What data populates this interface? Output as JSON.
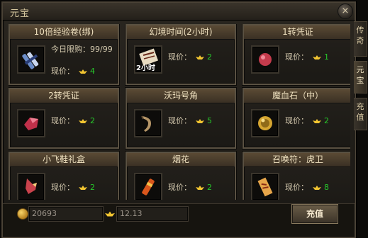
{
  "window": {
    "title": "元宝",
    "close_glyph": "×"
  },
  "side_tabs": [
    {
      "label": "传奇",
      "active": false
    },
    {
      "label": "元宝",
      "active": true
    },
    {
      "label": "充值",
      "active": false
    }
  ],
  "price_label": "现价：",
  "items": [
    {
      "name": "10倍经验卷(绑)",
      "icon": "scroll-icon",
      "limit": "今日限购：99/99",
      "price": "4"
    },
    {
      "name": "幻境时间(2小时)",
      "icon": "paper-icon",
      "badge": "2小时",
      "price": "2"
    },
    {
      "name": "1转凭证",
      "icon": "red-gem-icon",
      "price": "1"
    },
    {
      "name": "2转凭证",
      "icon": "red-crystal-icon",
      "price": "2"
    },
    {
      "name": "沃玛号角",
      "icon": "horn-icon",
      "price": "5"
    },
    {
      "name": "魔血石（中）",
      "icon": "gold-stone-icon",
      "price": "2"
    },
    {
      "name": "小飞鞋礼盒",
      "icon": "shoe-icon",
      "price": "2"
    },
    {
      "name": "烟花",
      "icon": "firework-icon",
      "price": "2"
    },
    {
      "name": "召唤符：虎卫",
      "icon": "talisman-icon",
      "price": "8"
    }
  ],
  "footer": {
    "gold_value": "20693",
    "yuanbao_value": "12.13",
    "recharge_label": "充值"
  },
  "colors": {
    "price_value": "#27c72b",
    "title_text": "#f0e2c0"
  }
}
